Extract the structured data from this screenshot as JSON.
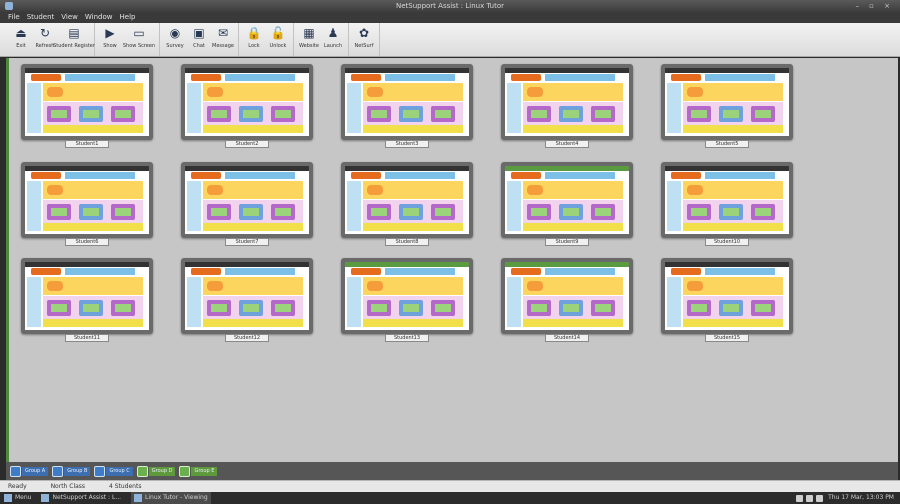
{
  "window": {
    "title": "NetSupport Assist : Linux Tutor"
  },
  "menubar": {
    "items": [
      "File",
      "Student",
      "View",
      "Window",
      "Help"
    ]
  },
  "toolbar": {
    "groups": [
      [
        {
          "label": "Exit",
          "icon": "exit-icon"
        },
        {
          "label": "Refresh",
          "icon": "refresh-icon"
        },
        {
          "label": "Student Register",
          "icon": "register-icon"
        }
      ],
      [
        {
          "label": "Show",
          "icon": "play-icon"
        },
        {
          "label": "Show Screen",
          "icon": "screen-icon"
        }
      ],
      [
        {
          "label": "Survey",
          "icon": "survey-icon"
        },
        {
          "label": "Chat",
          "icon": "chat-icon"
        },
        {
          "label": "Message",
          "icon": "message-icon"
        }
      ],
      [
        {
          "label": "Lock",
          "icon": "lock-icon"
        },
        {
          "label": "Unlock",
          "icon": "unlock-icon"
        }
      ],
      [
        {
          "label": "Website",
          "icon": "web-icon"
        },
        {
          "label": "Launch",
          "icon": "launch-icon"
        }
      ],
      [
        {
          "label": "NetSurf",
          "icon": "netsurf-icon"
        }
      ]
    ]
  },
  "students": [
    {
      "name": "Student1",
      "style": "dark"
    },
    {
      "name": "Student2",
      "style": "dark"
    },
    {
      "name": "Student3",
      "style": "dark"
    },
    {
      "name": "Student4",
      "style": "dark"
    },
    {
      "name": "Student5",
      "style": "dark"
    },
    {
      "name": "Student6",
      "style": "dark"
    },
    {
      "name": "Student7",
      "style": "dark"
    },
    {
      "name": "Student8",
      "style": "dark"
    },
    {
      "name": "Student9",
      "style": "green"
    },
    {
      "name": "Student10",
      "style": "dark"
    },
    {
      "name": "Student11",
      "style": "dark"
    },
    {
      "name": "Student12",
      "style": "dark"
    },
    {
      "name": "Student13",
      "style": "green"
    },
    {
      "name": "Student14",
      "style": "green"
    },
    {
      "name": "Student15",
      "style": "dark"
    }
  ],
  "groups": [
    {
      "name": "Group A",
      "color": "blue"
    },
    {
      "name": "Group B",
      "color": "blue"
    },
    {
      "name": "Group C",
      "color": "blue"
    },
    {
      "name": "Group D",
      "color": "green"
    },
    {
      "name": "Group E",
      "color": "green"
    }
  ],
  "status": {
    "mode": "Ready",
    "user": "North Class",
    "count": "4 Students"
  },
  "taskbar": {
    "items": [
      {
        "label": "Menu",
        "active": false
      },
      {
        "label": "NetSupport Assist : L...",
        "active": false
      },
      {
        "label": "Linux Tutor - Viewing",
        "active": true
      }
    ],
    "clock": "Thu 17 Mar, 13:03 PM"
  }
}
